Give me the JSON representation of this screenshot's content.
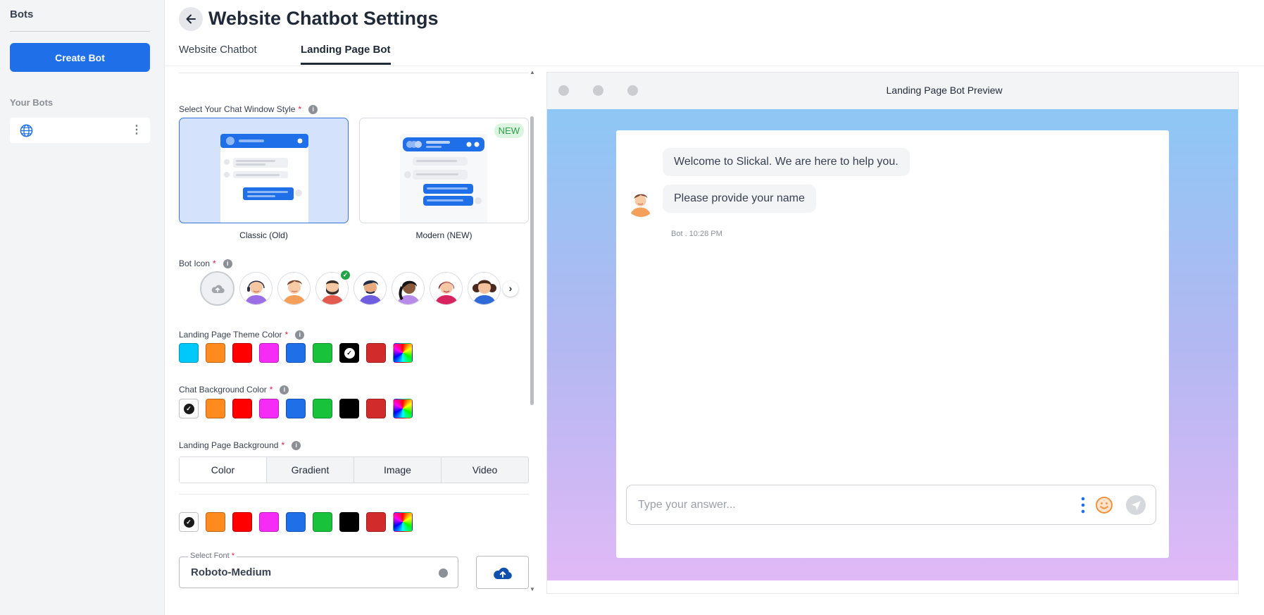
{
  "sidebar": {
    "title": "Bots",
    "create_button": "Create Bot",
    "section_label": "Your Bots",
    "bot_items": [
      {
        "icon": "globe-icon"
      }
    ]
  },
  "header": {
    "title": "Website Chatbot Settings",
    "tabs": [
      {
        "label": "Website Chatbot",
        "active": false
      },
      {
        "label": "Landing Page Bot",
        "active": true
      }
    ]
  },
  "settings": {
    "window_style": {
      "label": "Select Your Chat Window Style",
      "required": "*",
      "options": [
        {
          "caption": "Classic (Old)",
          "selected": true
        },
        {
          "caption": "Modern (NEW)",
          "selected": false,
          "badge": "NEW"
        }
      ]
    },
    "bot_icon": {
      "label": "Bot Icon",
      "required": "*",
      "avatars": [
        "avatar-headset-woman",
        "avatar-young-man",
        "avatar-bearded-man",
        "avatar-curly-man",
        "avatar-braid-woman",
        "avatar-pink-woman",
        "avatar-curly-woman"
      ],
      "selected_index": 2
    },
    "theme_color": {
      "label": "Landing Page Theme Color",
      "required": "*",
      "swatches": [
        "#00c8f8",
        "#ff8a1e",
        "#ff0000",
        "#f52cf5",
        "#1e6fe8",
        "#18c23b",
        "#000000",
        "#d22b2b",
        "rainbow"
      ],
      "selected_index": 6
    },
    "chat_bg_color": {
      "label": "Chat Background Color",
      "required": "*",
      "swatches": [
        "#ffffff",
        "#ff8a1e",
        "#ff0000",
        "#f52cf5",
        "#1e6fe8",
        "#18c23b",
        "#000000",
        "#d22b2b",
        "rainbow"
      ],
      "selected_index": 0
    },
    "landing_bg": {
      "label": "Landing Page Background",
      "required": "*",
      "tabs": [
        "Color",
        "Gradient",
        "Image",
        "Video"
      ],
      "active_tab": "Color",
      "swatches": [
        "#ffffff",
        "#ff8a1e",
        "#ff0000",
        "#f52cf5",
        "#1e6fe8",
        "#18c23b",
        "#000000",
        "#d22b2b",
        "rainbow"
      ],
      "selected_index": 0
    },
    "font": {
      "label": "Select Font",
      "required": "*",
      "value": "Roboto-Medium",
      "upload_icon": "cloud-upload-icon"
    }
  },
  "preview": {
    "title": "Landing Page Bot Preview",
    "messages": [
      "Welcome to Slickal. We are here to help you.",
      "Please provide your name"
    ],
    "meta": "Bot . 10:28 PM",
    "input_placeholder": "Type your answer...",
    "gradient": [
      "#8ec7f4",
      "#b3b8f2",
      "#e0b9f6"
    ]
  },
  "colors": {
    "accent": "#1e6fe8",
    "selected_card": "#d4e2fb",
    "new_badge": "#2e9d4a"
  }
}
